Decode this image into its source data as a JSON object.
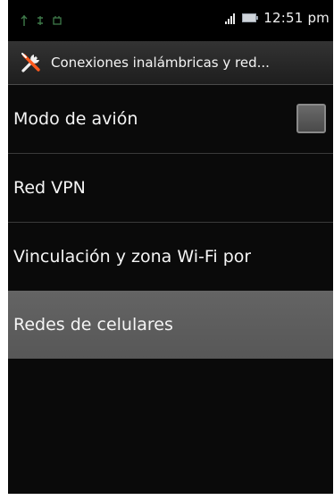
{
  "status_bar": {
    "time": "12:51 pm",
    "icons": [
      "usb-icon",
      "sync-icon",
      "notification-icon",
      "signal-icon",
      "battery-icon"
    ]
  },
  "title_bar": {
    "icon": "wrench-screwdriver-icon",
    "title": "Conexiones inalámbricas y red..."
  },
  "items": [
    {
      "label": "Modo de avión",
      "checkbox_checked": false
    },
    {
      "label": "Red VPN"
    },
    {
      "label": "Vinculación y zona Wi-Fi por"
    },
    {
      "label": "Redes de celulares",
      "highlighted": true
    }
  ],
  "colors": {
    "background": "#0a0a0a",
    "highlight": "#5e5e5e",
    "text": "#f5f5f5",
    "divider": "#3a3a3a"
  }
}
